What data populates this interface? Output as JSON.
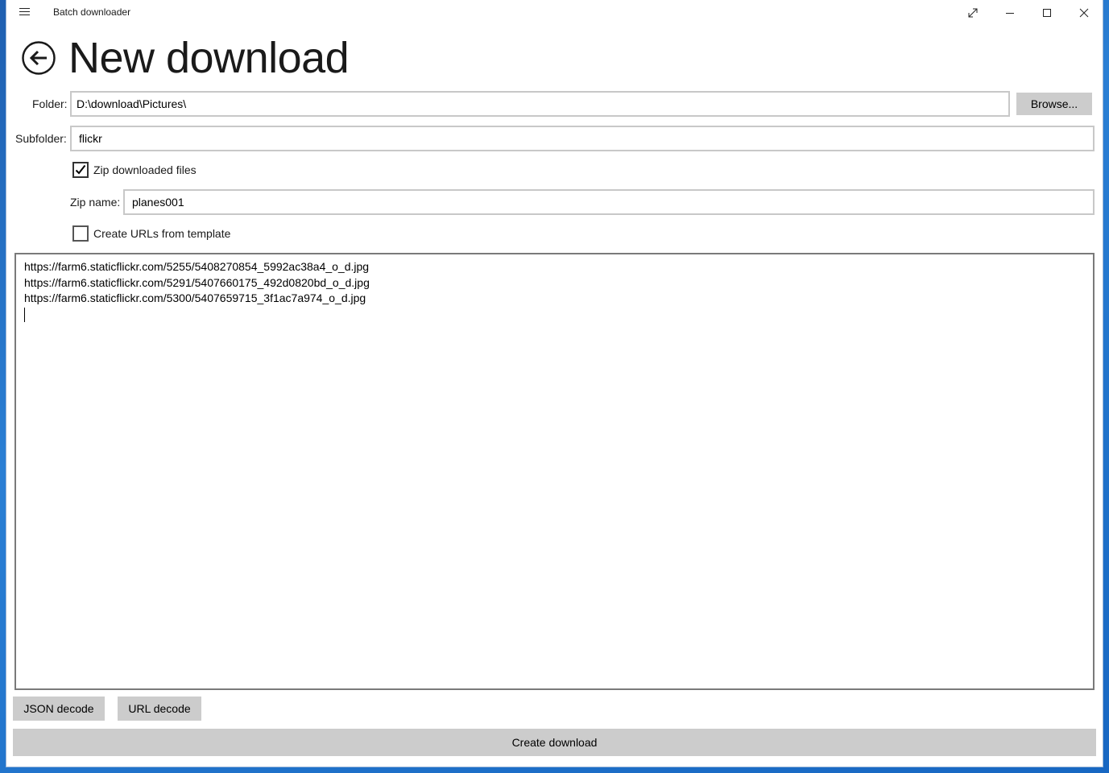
{
  "window": {
    "title": "Batch downloader"
  },
  "titlebar_icons": {
    "menu": "hamburger-icon",
    "fullscreen": "expand-diagonal-icon",
    "minimize": "minimize-icon",
    "maximize": "maximize-icon",
    "close": "close-icon"
  },
  "header": {
    "back_icon": "back-arrow-icon",
    "title": "New download"
  },
  "form": {
    "folder_label": "Folder:",
    "folder_value": "D:\\download\\Pictures\\",
    "browse_label": "Browse...",
    "subfolder_label": "Subfolder:",
    "subfolder_value": "flickr",
    "zip_checkbox_label": "Zip downloaded files",
    "zip_checked": true,
    "zip_name_label": "Zip name:",
    "zip_name_value": "planes001",
    "template_checkbox_label": "Create URLs from template",
    "template_checked": false
  },
  "urls": [
    "https://farm6.staticflickr.com/5255/5408270854_5992ac38a4_o_d.jpg",
    "https://farm6.staticflickr.com/5291/5407660175_492d0820bd_o_d.jpg",
    "https://farm6.staticflickr.com/5300/5407659715_3f1ac7a974_o_d.jpg"
  ],
  "actions": {
    "json_decode_label": "JSON decode",
    "url_decode_label": "URL decode",
    "create_download_label": "Create download"
  },
  "colors": {
    "button_bg": "#cccccc",
    "input_border": "#c8c8c8",
    "desktop_bg": "#1f6fc8"
  }
}
